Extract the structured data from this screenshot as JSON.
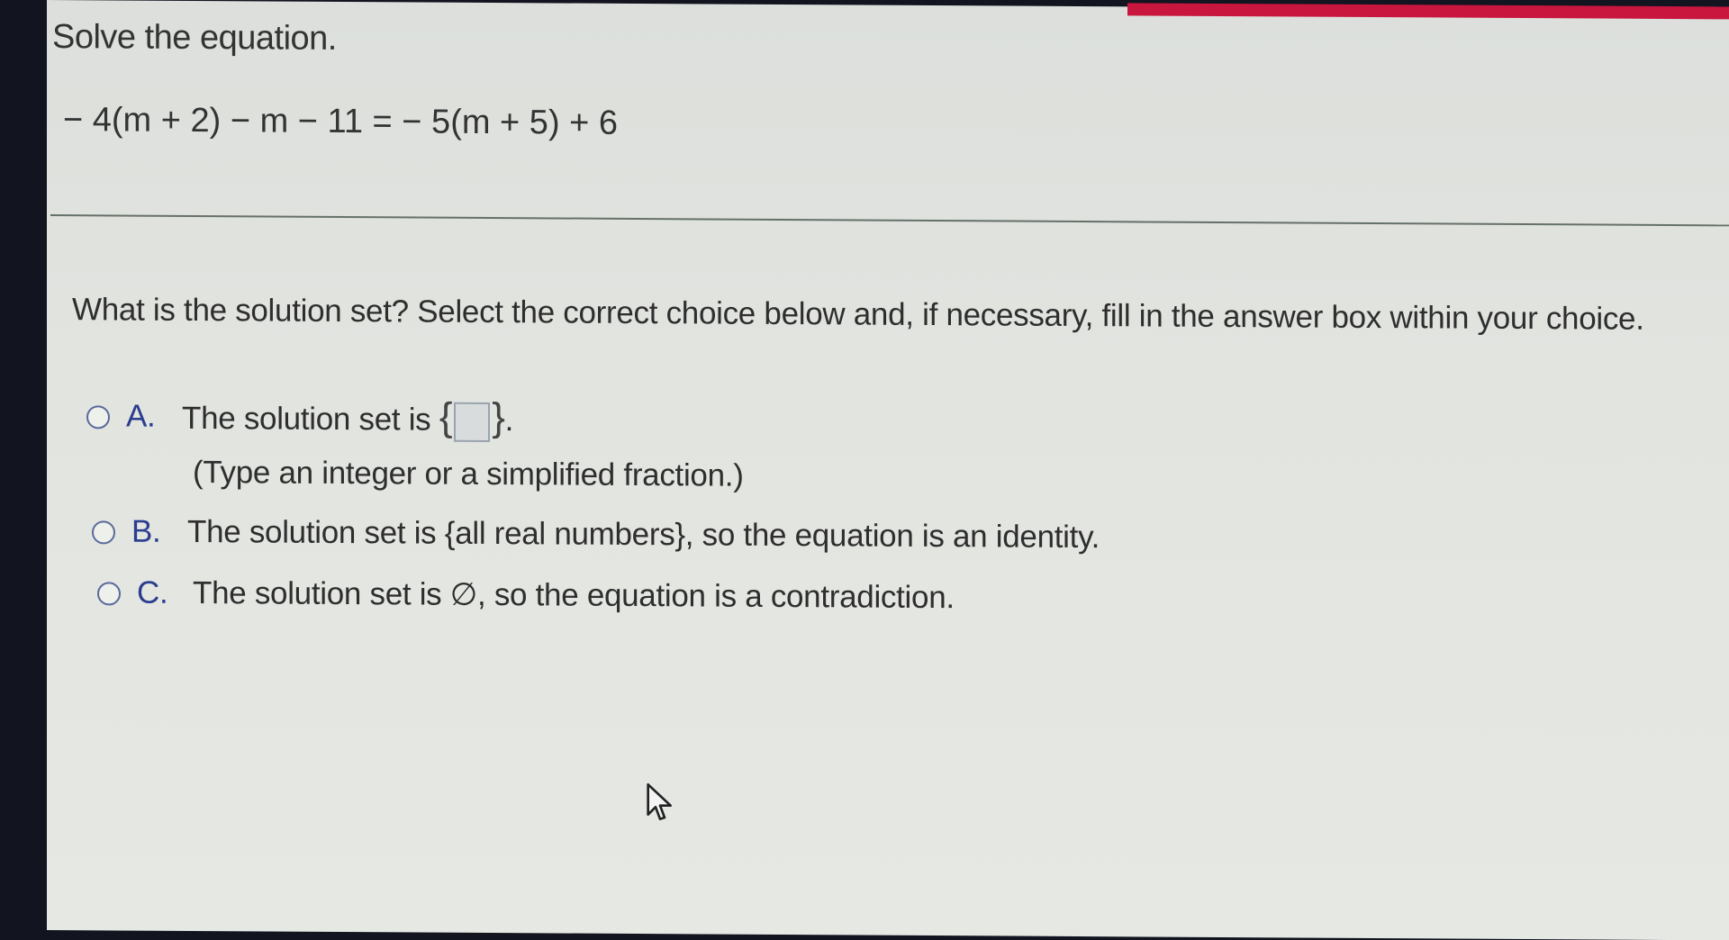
{
  "question": {
    "header": "Solve the equation.",
    "equation": "− 4(m + 2) − m − 11 = − 5(m + 5) + 6",
    "prompt": "What is the solution set? Select the correct choice below and, if necessary, fill in the answer box within your choice."
  },
  "choices": [
    {
      "letter": "A.",
      "text_before": "The solution set is ",
      "brace_open": "{",
      "brace_close": "}",
      "text_after": ".",
      "answer_value": "",
      "hint": "(Type an integer or a simplified fraction.)",
      "selected": false
    },
    {
      "letter": "B.",
      "text": "The solution set is {all real numbers}, so the equation is an identity.",
      "selected": false
    },
    {
      "letter": "C.",
      "text": "The solution set is ∅, so the equation is a contradiction.",
      "selected": false
    }
  ],
  "colors": {
    "accent_strip": "#c8163e",
    "choice_letter": "#2b3d8f",
    "radio_border": "#5a6a9a"
  }
}
